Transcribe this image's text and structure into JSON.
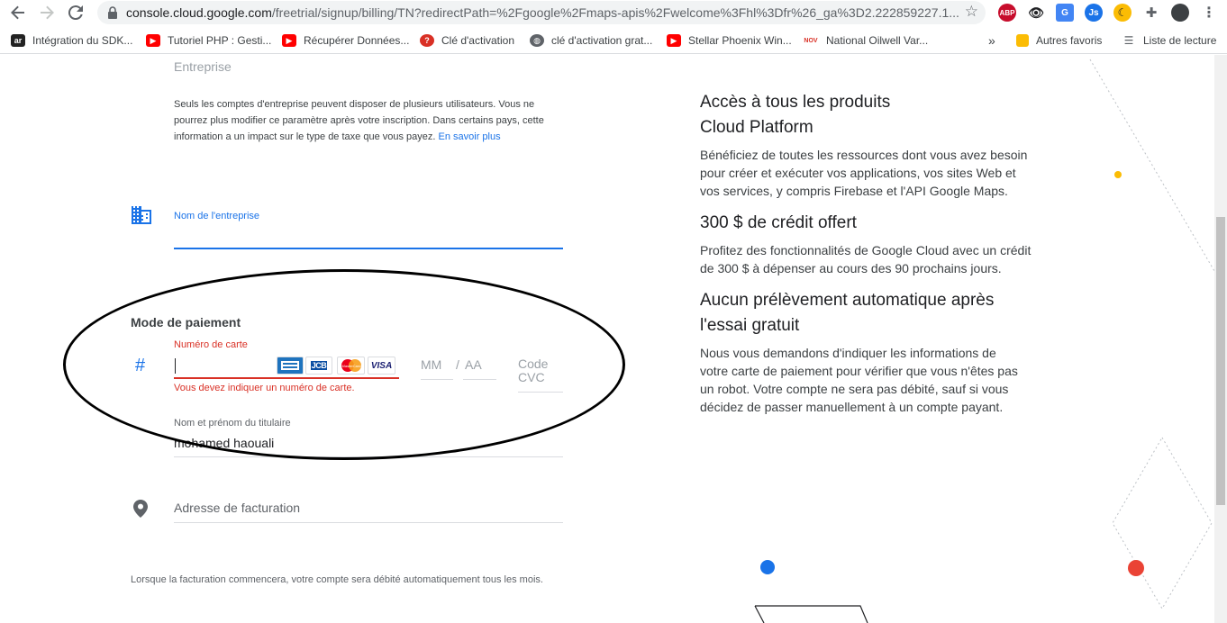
{
  "browser": {
    "url_host": "console.cloud.google.com",
    "url_path": "/freetrial/signup/billing/TN?redirectPath=%2Fgoogle%2Fmaps-apis%2Fwelcome%3Fhl%3Dfr%26_ga%3D2.222859227.1...",
    "extensions": [
      {
        "name": "abp-icon",
        "label": "ABP",
        "color": "#c70d2c"
      },
      {
        "name": "eye-icon",
        "label": "",
        "color": "#ffffff"
      },
      {
        "name": "translate-icon",
        "label": "G",
        "color": "#4285f4"
      },
      {
        "name": "js-icon",
        "label": "Js",
        "color": "#1a73e8"
      },
      {
        "name": "moon-icon",
        "label": "",
        "color": "#fbbc04"
      },
      {
        "name": "puzzle-icon",
        "label": "",
        "color": "#ffffff"
      }
    ]
  },
  "bookmarks": {
    "items": [
      {
        "label": "Intégration du SDK...",
        "icon": "ar"
      },
      {
        "label": "Tutoriel PHP : Gesti...",
        "icon": "youtube"
      },
      {
        "label": "Récupérer Données...",
        "icon": "youtube"
      },
      {
        "label": "Clé d'activation",
        "icon": "question"
      },
      {
        "label": "clé d'activation grat...",
        "icon": "globe"
      },
      {
        "label": "Stellar Phoenix Win...",
        "icon": "youtube"
      },
      {
        "label": "National Oilwell Var...",
        "icon": "nov"
      }
    ],
    "overflow": "»",
    "other_favorites": "Autres favoris",
    "reading_list": "Liste de lecture",
    "ar_text": "ar",
    "nov_text": "NOV"
  },
  "form": {
    "account_type_value": "Entreprise",
    "account_info_text": "Seuls les comptes d'entreprise peuvent disposer de plusieurs utilisateurs. Vous ne pourrez plus modifier ce paramètre après votre inscription. Dans certains pays, cette information a un impact sur le type de taxe que vous payez. ",
    "learn_more": "En savoir plus",
    "company_name_label": "Nom de l'entreprise",
    "payment_title": "Mode de paiement",
    "card_number_label": "Numéro de carte",
    "card_error": "Vous devez indiquer un numéro de carte.",
    "month_placeholder": "MM",
    "slash": "/",
    "year_placeholder": "AA",
    "cvc_placeholder": "Code CVC",
    "holder_label": "Nom et prénom du titulaire",
    "holder_value": "mohamed haouali",
    "address_placeholder": "Adresse de facturation",
    "footer_text": "Lorsque la facturation commencera, votre compte sera débité automatiquement tous les mois.",
    "card_brands": [
      "amex",
      "jcb",
      "mastercard",
      "visa"
    ],
    "visa_text": "VISA",
    "jcb_text": "JCB",
    "mastercard_text": "MasterCard"
  },
  "benefits": [
    {
      "title": "Accès à tous les produits Cloud Platform",
      "text": "Bénéficiez de toutes les ressources dont vous avez besoin pour créer et exécuter vos applications, vos sites Web et vos services, y compris Firebase et l'API Google Maps."
    },
    {
      "title": "300 $ de crédit offert",
      "text": "Profitez des fonctionnalités de Google Cloud avec un crédit de 300 $ à dépenser au cours des 90 prochains jours."
    },
    {
      "title": "Aucun prélèvement automatique après l'essai gratuit",
      "text": "Nous vous demandons d'indiquer les informations de votre carte de paiement pour vérifier que vous n'êtes pas un robot. Votre compte ne sera pas débité, sauf si vous décidez de passer manuellement à un compte payant."
    }
  ],
  "colors": {
    "accent": "#1a73e8",
    "error": "#d93025",
    "dot_yellow": "#fbbc04",
    "dot_blue": "#1a73e8",
    "dot_red": "#ea4335"
  }
}
